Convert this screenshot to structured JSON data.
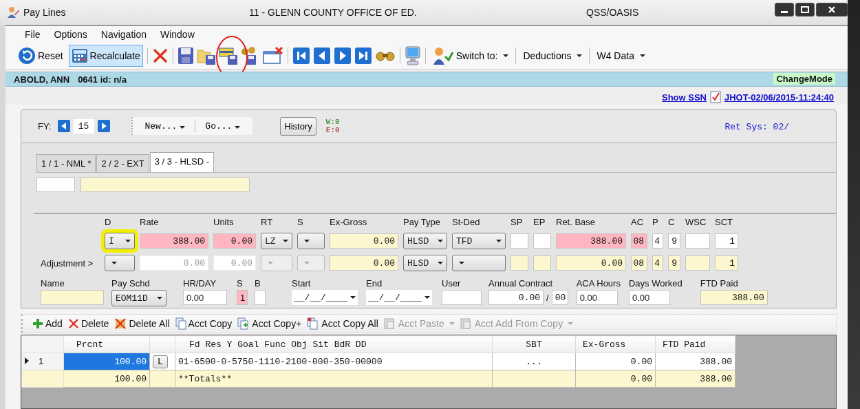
{
  "window": {
    "title": "Pay Lines",
    "organization": "11 - GLENN COUNTY OFFICE OF ED.",
    "app": "QSS/OASIS"
  },
  "menu": [
    "File",
    "Options",
    "Navigation",
    "Window"
  ],
  "toolbar": {
    "reset": "Reset",
    "recalculate": "Recalculate",
    "recalculate_selected": true,
    "switch_to": "Switch to:",
    "deductions": "Deductions",
    "w4_data": "W4 Data"
  },
  "employee": {
    "name": "ABOLD, ANN",
    "number": "0641 id: n/a",
    "mode": "ChangeMode"
  },
  "links": {
    "show_ssn": "Show SSN",
    "audit": "JHOT-02/06/2015-11:24:40"
  },
  "header": {
    "fy_label": "FY:",
    "fy": "15",
    "new": "New...",
    "go": "Go...",
    "history": "History",
    "warnings": "W:0",
    "errors": "E:0",
    "ret_sys": "Ret Sys: 02/"
  },
  "tabs": [
    {
      "label": "1 / 1 - NML *",
      "selected": false
    },
    {
      "label": "2 / 2 - EXT",
      "selected": false
    },
    {
      "label": "3 / 3 - HLSD -",
      "selected": true
    }
  ],
  "line_fields": {
    "columns": [
      "D",
      "Rate",
      "Units",
      "RT",
      "S",
      "Ex-Gross",
      "Pay Type",
      "St-Ded",
      "SP",
      "EP",
      "Ret. Base",
      "AC",
      "P",
      "C",
      "WSC",
      "SCT"
    ],
    "rows": [
      {
        "cells": [
          {
            "kind": "select",
            "value": "I",
            "disabled": false
          },
          {
            "kind": "input",
            "value": "388.00",
            "color": "#ffb6c1",
            "disabled": false
          },
          {
            "kind": "input",
            "value": "0.00",
            "color": "#ffb6c1",
            "disabled": false
          },
          {
            "kind": "select",
            "value": "LZ",
            "disabled": false
          },
          {
            "kind": "select",
            "disabled": false
          },
          {
            "kind": "input",
            "value": "0.00",
            "color": "#fdf7cf",
            "disabled": false
          },
          {
            "kind": "select",
            "value": "HLSD",
            "disabled": false
          },
          {
            "kind": "select",
            "value": "TFD",
            "disabled": false
          },
          {
            "kind": "input",
            "color": "#ffffff",
            "disabled": false
          },
          {
            "kind": "input",
            "color": "#ffffff",
            "disabled": false
          },
          {
            "kind": "input",
            "value": "388.00",
            "color": "#ffb6c1",
            "disabled": false
          },
          {
            "kind": "input",
            "value": "08",
            "color": "#ffb6c1",
            "disabled": false
          },
          {
            "kind": "input",
            "value": "4",
            "color": "#ffffff",
            "disabled": false
          },
          {
            "kind": "input",
            "value": "9",
            "color": "#ffffff",
            "disabled": false
          },
          {
            "kind": "input",
            "color": "#ffffff",
            "disabled": false
          },
          {
            "kind": "input",
            "value": "1",
            "color": "#ffffff",
            "disabled": false
          }
        ]
      },
      {
        "label": "Adjustment  >",
        "cells": [
          {
            "kind": "select",
            "disabled": false
          },
          {
            "kind": "input",
            "value": "0.00",
            "color": "#ffffff",
            "disabled": true
          },
          {
            "kind": "input",
            "value": "0.00",
            "color": "#ffffff",
            "disabled": true
          },
          {
            "kind": "select",
            "disabled": true
          },
          {
            "kind": "select",
            "disabled": true
          },
          {
            "kind": "input",
            "value": "0.00",
            "color": "#fdf7cf",
            "disabled": false
          },
          {
            "kind": "select",
            "value": "HLSD",
            "disabled": false
          },
          {
            "kind": "select",
            "disabled": false
          },
          {
            "kind": "input",
            "color": "#fdf7cf",
            "disabled": false
          },
          {
            "kind": "input",
            "color": "#fdf7cf",
            "disabled": false
          },
          {
            "kind": "input",
            "value": "0.00",
            "color": "#fdf7cf",
            "disabled": false
          },
          {
            "kind": "input",
            "value": "08",
            "color": "#fdf7cf",
            "disabled": false
          },
          {
            "kind": "input",
            "value": "4",
            "color": "#fdf7cf",
            "disabled": false
          },
          {
            "kind": "input",
            "value": "9",
            "color": "#fdf7cf",
            "disabled": false
          },
          {
            "kind": "input",
            "color": "#fdf7cf",
            "disabled": false
          },
          {
            "kind": "input",
            "value": "1",
            "color": "#fdf7cf",
            "disabled": false
          }
        ]
      }
    ]
  },
  "detail_fields": [
    {
      "label": "Name",
      "kind": "input",
      "color": "#fdf7cf"
    },
    {
      "label": "Pay Schd",
      "kind": "select",
      "value": "EOM11D"
    },
    {
      "label": "HR/DAY",
      "kind": "input",
      "value": "0.00",
      "color": "#ffffff"
    },
    {
      "label": "S",
      "kind": "input",
      "value": "1",
      "color": "#ffb6c1"
    },
    {
      "label": "B",
      "kind": "input",
      "color": "#ffffff"
    },
    {
      "label": "Start",
      "kind": "date",
      "value": "__/__/____"
    },
    {
      "label": "End",
      "kind": "date",
      "value": "__/__/____"
    },
    {
      "label": "User",
      "kind": "input",
      "color": "#ffffff"
    },
    {
      "label": "Annual Contract",
      "kind": "contract",
      "value": "0.00",
      "separator": "/",
      "extra": "00",
      "color": "#ffffff"
    },
    {
      "label": "ACA Hours",
      "kind": "input",
      "value": "0.00",
      "color": "#ffffff"
    },
    {
      "label": "Days Worked",
      "kind": "input",
      "value": "0.00",
      "color": "#ffffff"
    },
    {
      "label": "FTD Paid",
      "kind": "amount",
      "value": "388.00",
      "color": "#fdf7cf"
    }
  ],
  "grid_toolbar": [
    {
      "label": "Add",
      "disabled": false,
      "dropdown": false
    },
    {
      "label": "Delete",
      "disabled": false,
      "dropdown": false
    },
    {
      "label": "Delete All",
      "disabled": false,
      "dropdown": false
    },
    {
      "label": "Acct Copy",
      "disabled": false,
      "dropdown": false
    },
    {
      "label": "Acct Copy+",
      "disabled": false,
      "dropdown": false
    },
    {
      "label": "Acct Copy All",
      "disabled": false,
      "dropdown": false
    },
    {
      "label": "Acct Paste",
      "disabled": true,
      "dropdown": true
    },
    {
      "label": "Acct Add From Copy",
      "disabled": true,
      "dropdown": true
    }
  ],
  "table": {
    "columns": [
      "Prcnt",
      "Fd Res  Y Goal Func Obj  Sit BdR DD",
      "SBT",
      "Ex-Gross",
      "FTD Paid"
    ],
    "rows": [
      {
        "kind": "line",
        "number": "1",
        "selected": true,
        "prcnt": "100.00",
        "button": "L",
        "account": "01-6500-0-5750-1110-2100-000-350-00000",
        "sbt": "...",
        "ex_gross": "0.00",
        "ftd_paid": "388.00"
      },
      {
        "kind": "totals",
        "selected": false,
        "prcnt": "100.00",
        "account": "**Totals**",
        "ex_gross": "0.00",
        "ftd_paid": "388.00"
      }
    ]
  }
}
